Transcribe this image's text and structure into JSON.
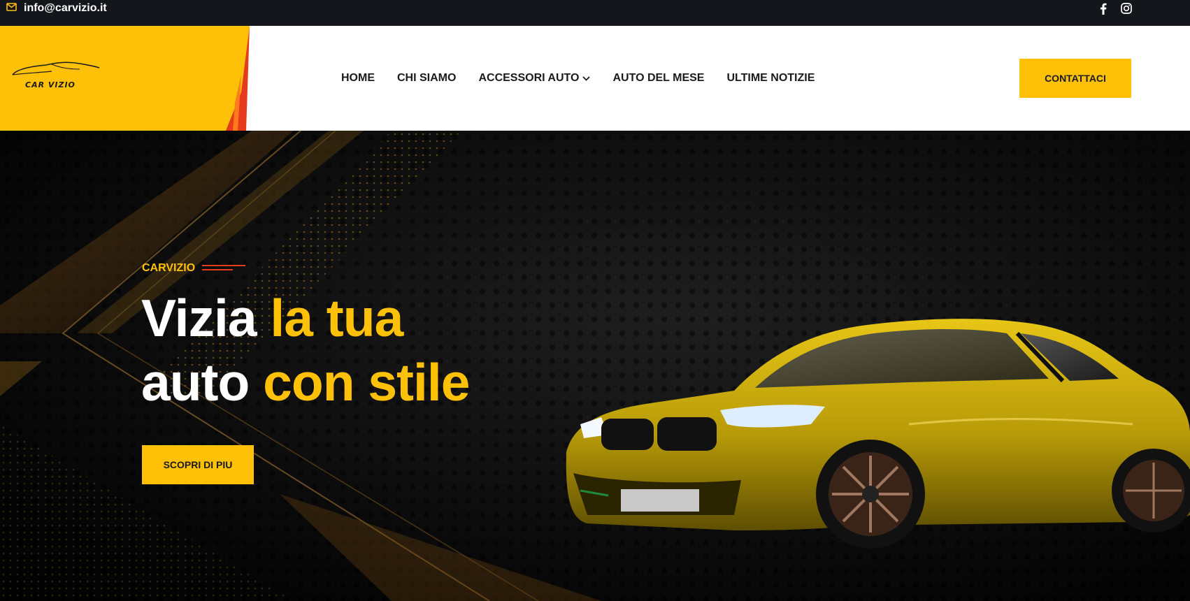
{
  "topbar": {
    "email": "info@carvizio.it",
    "email_icon": "envelope-icon",
    "social_icons": [
      "facebook-icon",
      "instagram-icon"
    ]
  },
  "header": {
    "logo_text": "CAR VIZIO",
    "nav": [
      {
        "label": "HOME"
      },
      {
        "label": "CHI SIAMO"
      },
      {
        "label": "ACCESSORI AUTO",
        "icon": "chevron-down-icon"
      },
      {
        "label": "AUTO DEL MESE"
      },
      {
        "label": "ULTIME NOTIZIE"
      }
    ],
    "cta_label": "CONTATTACI"
  },
  "hero": {
    "eyebrow": "CARVIZIO",
    "headline_line1_white": "Vizia",
    "headline_line1_yellow": "la tua",
    "headline_line2_white": "auto",
    "headline_line2_yellow": "con stile",
    "button_label": "SCOPRI DI PIU"
  },
  "colors": {
    "accent": "#ffc107",
    "accent_red": "#e53a1b",
    "topbar_bg": "#15161c",
    "header_bg": "#ffffff",
    "hero_bg": "#0b0b0b",
    "text_dark": "#1b1b1f"
  }
}
